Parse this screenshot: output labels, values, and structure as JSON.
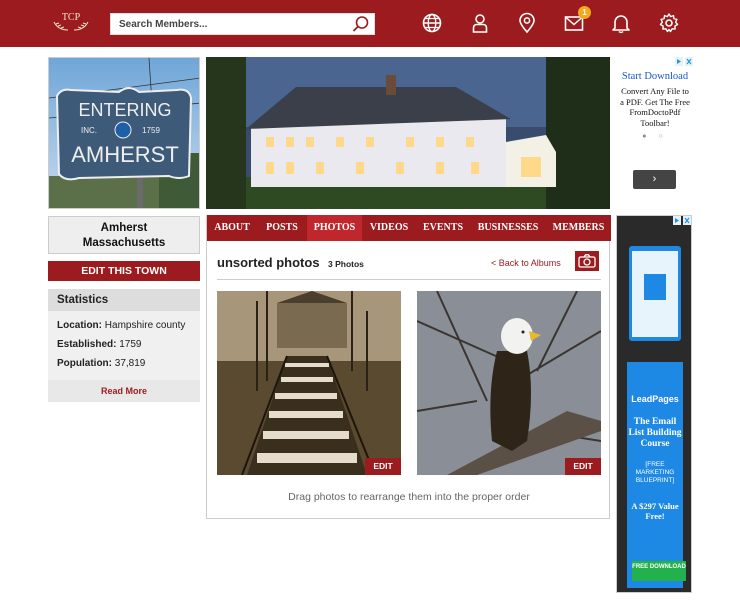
{
  "header": {
    "logo_text": "TCP",
    "search_placeholder": "Search Members...",
    "notification_count": "1"
  },
  "town": {
    "sign_line1": "ENTERING",
    "sign_inc": "INC.",
    "sign_year": "1759",
    "sign_line2": "AMHERST",
    "name": "Amherst",
    "state": "Massachusetts",
    "edit_label": "EDIT THIS TOWN"
  },
  "statistics": {
    "title": "Statistics",
    "location_label": "Location:",
    "location_value": "Hampshire county",
    "established_label": "Established:",
    "established_value": "1759",
    "population_label": "Population:",
    "population_value": "37,819",
    "read_more": "Read More"
  },
  "tabs": [
    "ABOUT",
    "POSTS",
    "PHOTOS",
    "VIDEOS",
    "EVENTS",
    "BUSINESSES",
    "MEMBERS"
  ],
  "active_tab": "PHOTOS",
  "album": {
    "title": "unsorted photos",
    "count": "3 Photos",
    "back_label": "< Back to Albums",
    "edit_label": "EDIT",
    "hint": "Drag photos to rearrange them into the proper order"
  },
  "ad_top": {
    "title": "Start Download",
    "text": "Convert Any File to a PDF. Get The Free FromDoctoPdf Toolbar!",
    "next": "›"
  },
  "ad_side": {
    "brand": "LeadPages",
    "headline": "The Email List Building Course",
    "sub": "[FREE MARKETING BLUEPRINT]",
    "price": "A $297 Value Free!",
    "cta": "FREE DOWNLOAD"
  },
  "colors": {
    "brand": "#9b1b1e",
    "active_tab": "#c0272d",
    "badge": "#f4a81c",
    "ad_blue": "#1e88e5"
  }
}
